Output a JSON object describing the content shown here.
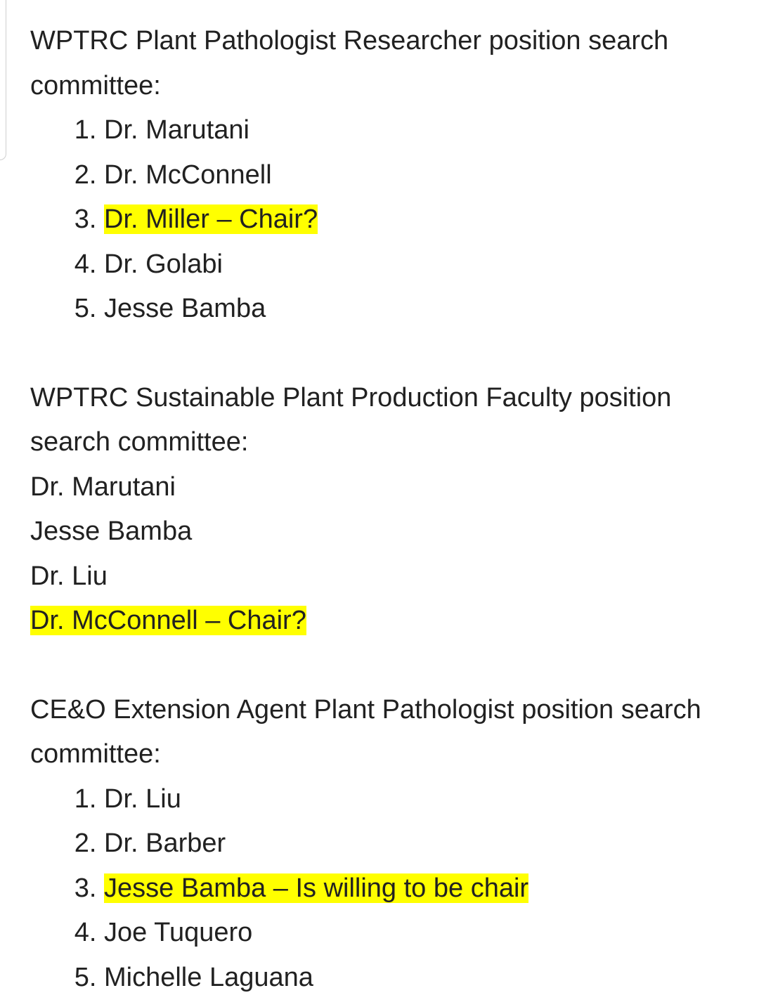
{
  "sections": [
    {
      "heading": "WPTRC Plant Pathologist Researcher position search committee:",
      "list_style": "numbered",
      "members": [
        {
          "text": "Dr. Marutani",
          "highlighted": false
        },
        {
          "text": "Dr. McConnell",
          "highlighted": false
        },
        {
          "text": "Dr. Miller – Chair?",
          "highlighted": true
        },
        {
          "text": "Dr. Golabi",
          "highlighted": false
        },
        {
          "text": "Jesse Bamba",
          "highlighted": false
        }
      ]
    },
    {
      "heading": "WPTRC Sustainable Plant Production Faculty position search committee:",
      "list_style": "plain",
      "members": [
        {
          "text": "Dr. Marutani",
          "highlighted": false
        },
        {
          "text": "Jesse Bamba",
          "highlighted": false
        },
        {
          "text": "Dr. Liu",
          "highlighted": false
        },
        {
          "text": "Dr. McConnell – Chair?",
          "highlighted": true
        }
      ]
    },
    {
      "heading": "CE&O Extension Agent Plant Pathologist position search committee:",
      "list_style": "numbered",
      "members": [
        {
          "text": "Dr. Liu",
          "highlighted": false
        },
        {
          "text": "Dr. Barber",
          "highlighted": false
        },
        {
          "text": "Jesse Bamba – Is willing to be chair",
          "highlighted": true
        },
        {
          "text": "Joe Tuquero",
          "highlighted": false
        },
        {
          "text": "Michelle Laguana",
          "highlighted": false
        }
      ]
    }
  ],
  "colors": {
    "text": "#212121",
    "highlight": "#ffff00",
    "background": "#ffffff"
  }
}
